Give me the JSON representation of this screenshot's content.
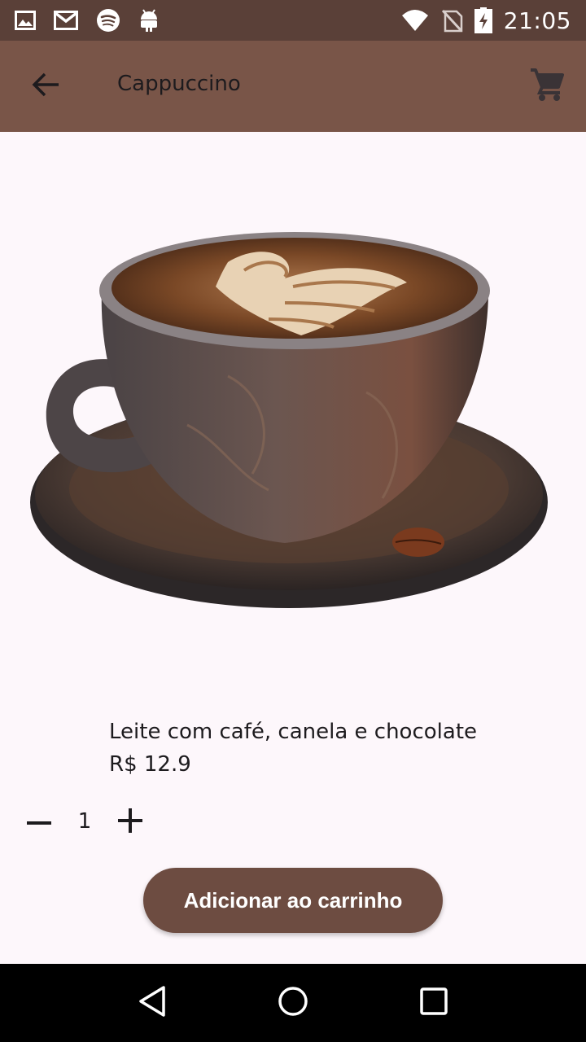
{
  "status_bar": {
    "time": "21:05",
    "left_icons": [
      "gallery-icon",
      "gmail-icon",
      "spotify-icon",
      "android-icon"
    ],
    "right_icons": [
      "wifi-icon",
      "no-signal-icon",
      "battery-charging-icon"
    ]
  },
  "app_bar": {
    "title": "Cappuccino",
    "back_icon": "arrow-back-icon",
    "cart_icon": "shopping-cart-icon"
  },
  "product": {
    "description": "Leite com café, canela e chocolate",
    "price": "R$ 12.9",
    "quantity": "1"
  },
  "actions": {
    "add_to_cart_label": "Adicionar ao carrinho"
  },
  "colors": {
    "status_bar": "#5a4038",
    "app_bar": "#795548",
    "button": "#6d4c41",
    "background": "#fdf7fb"
  },
  "nav_bar": {
    "icons": [
      "back-triangle-icon",
      "home-circle-icon",
      "recents-square-icon"
    ]
  }
}
